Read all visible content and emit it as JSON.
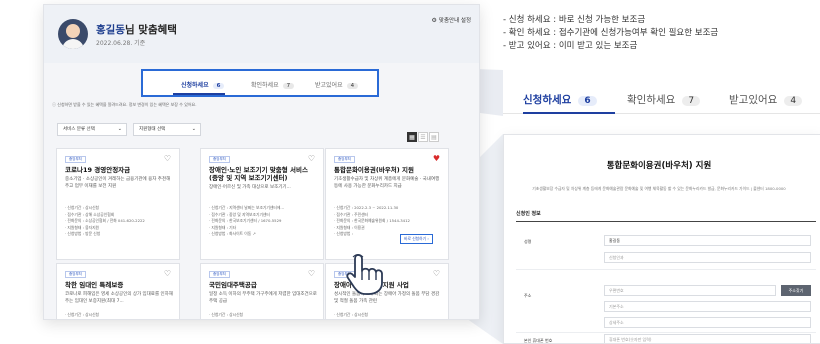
{
  "header": {
    "user_name": "홍길동",
    "greeting_suffix": "님 맞춤혜택",
    "date": "2022.06.28. 기준",
    "settings_label": "맞춤안내 설정"
  },
  "tabs": [
    {
      "label": "신청하세요",
      "count": "6"
    },
    {
      "label": "확인하세요",
      "count": "7"
    },
    {
      "label": "받고있어요",
      "count": "4"
    }
  ],
  "notice": "ⓘ 신청하면 받을 수 있는 혜택을 알려드려요. 정보 변경이 있는 혜택은 보장 수 있어요.",
  "filters": {
    "category": "서비스 분류 선택",
    "region": "지원형태 선택"
  },
  "cards": [
    {
      "tag": "중앙부처",
      "title": "코로나19 경영안정자금",
      "desc": "중소기업 · 소상공인이 겨레하는 금융기관에 융자 추천해주고 업무 이재를 보전 지원",
      "meta": [
        "· 신청기간 : 상시신청",
        "· 접수기관 : 상해 소상공인협회",
        "· 전화문의 : 소상공인협회 / 전화 041-620-2222",
        "· 지원형태 : 융자지원",
        "· 신청방법 : 방문 신청"
      ]
    },
    {
      "tag": "중앙부처",
      "title": "장애인·노인 보조기기 맞춤형 서비스 (중앙 및 지역 보조기기센터)",
      "desc": "장애인·어르신 및 가족 대상으로 보조기기...",
      "meta": [
        "· 신청기간 : 지역센터 날짜는 보조기기센터에...",
        "· 접수기관 : 중앙 및 지역보조기기센터",
        "· 전화문의 : 한국보조기기센터 / 1670-5529",
        "· 지원형태 : 기타",
        "· 신청방법 : 화사이트 이동 ↗"
      ]
    },
    {
      "tag": "중앙부처",
      "title": "통합문화이용권(바우처) 지원",
      "desc": "기초생활수급자 및 차상위 계층에게 문화예술 · 국내여행 등에 사용 가능한 문화누리카드 지급",
      "meta": [
        "· 신청기간 : 2022.2.3 ~ 2022.11.30",
        "· 접수기관 : 주민센터",
        "· 전화문의 : 한국문화예술위원회 / 1544-3412",
        "· 지원형태 : 이용권",
        "· 신청방법 :"
      ],
      "apply_button": "바로 신청하기 ›",
      "liked": true
    },
    {
      "tag": "중앙부처",
      "title": "착한 임대인 특례보증",
      "desc": "코로나로 피해입은 영세 소상공인의 상가 임대료를 인하해주는 임대인 보증지원(최대 7...",
      "meta": [
        "· 신청기간 : 상시신청"
      ]
    },
    {
      "tag": "중앙부처",
      "title": "국민임대주택공급",
      "desc": "일정 소득 이하의 무주택 가구주에게 저렴한 임대조건으로 주택 공급",
      "meta": [
        "· 신청기간 : 상시신청"
      ]
    },
    {
      "tag": "중앙부처",
      "title": "장애아 가족 양육 지원 사업",
      "desc": "성시적인 돌봄이 요구되는 장애아 가정의 돌봄 부담 경감 및 적절 돌봄 가족 관련",
      "meta": [
        "· 신청기간 : 상시신청"
      ]
    }
  ],
  "legend": [
    "- 신청 하세요 : 바로 신청 가능한 보조금",
    "- 확인 하세요 : 접수기관에 신청가능여부 확인 필요한 보조금",
    "- 받고 있어요 : 이미 받고 있는 보조금"
  ],
  "detail": {
    "title": "통합문화이용권(바우처) 지원",
    "subtitle": "기초생활보장 수급자 및 차상위 계층 등에게 문화예술관람 문화예술 및 여행 체육활동 할 수 있는 문화누리카드 발급, 문화누리카드 가이드 | 콜센터 1800-0000",
    "section_title": "신청인 정보",
    "fields": {
      "name_label": "성명",
      "name_value": "홍길동",
      "relation_placeholder": "신청인과",
      "address_label": "주소",
      "postcode_placeholder": "우편번호",
      "search_button": "주소찾기",
      "address_placeholder": "기본주소",
      "address_detail_placeholder": "상세주소",
      "phone_label": "본인 휴대폰 번호",
      "phone_placeholder": "휴대폰 번호(숫자만 입력)"
    }
  },
  "colors": {
    "accent": "#1e3fa0",
    "highlight_box": "#2a6ad6",
    "heart_liked": "#d92b2b"
  }
}
